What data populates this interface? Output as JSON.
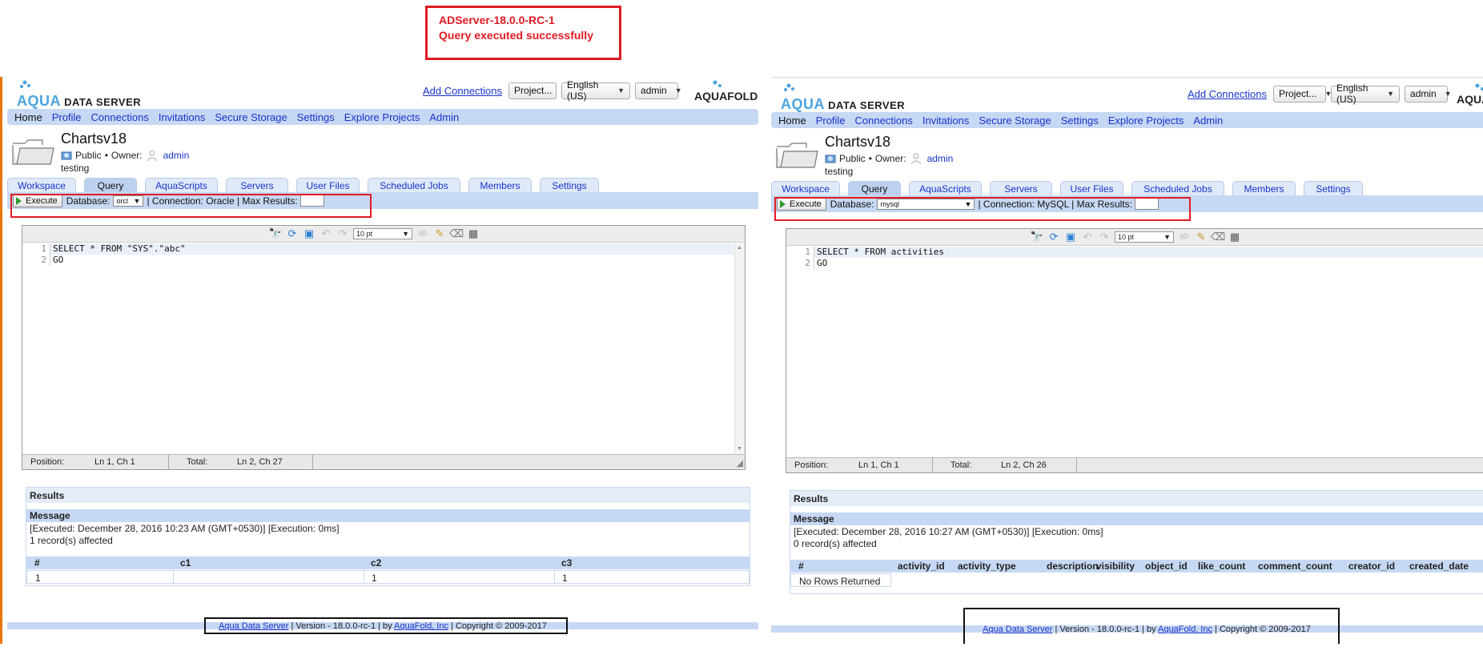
{
  "annotation": {
    "line1": "ADServer-18.0.0-RC-1",
    "line2": "Query executed successfully"
  },
  "panels": [
    {
      "logo": {
        "prefix": "AQUA",
        "suffix": "DATA SERVER"
      },
      "top": {
        "add_connections": "Add Connections",
        "project": "Project...",
        "language": "English (US)",
        "user": "admin",
        "brand": "AQUAFOLD"
      },
      "nav": [
        "Home",
        "Profile",
        "Connections",
        "Invitations",
        "Secure Storage",
        "Settings",
        "Explore Projects",
        "Admin"
      ],
      "project": {
        "name": "Chartsv18",
        "visibility": "Public",
        "bullet": "•",
        "owner_label": "Owner:",
        "owner": "admin",
        "description": "testing"
      },
      "tabs": [
        "Workspace",
        "Query",
        "AquaScripts",
        "Servers",
        "User Files",
        "Scheduled Jobs",
        "Members",
        "Settings"
      ],
      "toolbar": {
        "execute": "Execute",
        "database_label": "Database:",
        "database": "orcl",
        "connection_text": "| Connection: Oracle | Max Results:"
      },
      "editor": {
        "font_size": "10 pt",
        "lines": [
          "SELECT * FROM \"SYS\".\"abc\"",
          "GO"
        ],
        "line_numbers": [
          "1",
          "2"
        ],
        "status": {
          "position_label": "Position:",
          "position": "Ln 1, Ch 1",
          "total_label": "Total:",
          "total": "Ln 2, Ch 27"
        }
      },
      "results": {
        "title": "Results",
        "message_label": "Message",
        "executed": "[Executed: December 28, 2016 10:23 AM (GMT+0530)] [Execution: 0ms]",
        "affected": "1 record(s) affected",
        "columns": [
          "#",
          "c1",
          "c2",
          "c3"
        ],
        "row": [
          "1",
          "",
          "1",
          "1"
        ]
      },
      "footer": {
        "link1": "Aqua Data Server",
        "mid": "| Version - 18.0.0-rc-1 | by",
        "link2": "AquaFold, Inc",
        "end": "| Copyright © 2009-2017"
      }
    },
    {
      "logo": {
        "prefix": "AQUA",
        "suffix": "DATA SERVER"
      },
      "top": {
        "add_connections": "Add Connections",
        "project": "Project...",
        "language": "English (US)",
        "user": "admin",
        "brand": "AQUAFOLD"
      },
      "nav": [
        "Home",
        "Profile",
        "Connections",
        "Invitations",
        "Secure Storage",
        "Settings",
        "Explore Projects",
        "Admin"
      ],
      "project": {
        "name": "Chartsv18",
        "visibility": "Public",
        "bullet": "•",
        "owner_label": "Owner:",
        "owner": "admin",
        "description": "testing"
      },
      "tabs": [
        "Workspace",
        "Query",
        "AquaScripts",
        "Servers",
        "User Files",
        "Scheduled Jobs",
        "Members",
        "Settings"
      ],
      "toolbar": {
        "execute": "Execute",
        "database_label": "Database:",
        "database": "mysql",
        "connection_text": "| Connection: MySQL | Max Results:"
      },
      "editor": {
        "font_size": "10 pt",
        "lines": [
          "SELECT * FROM activities",
          "GO"
        ],
        "line_numbers": [
          "1",
          "2"
        ],
        "status": {
          "position_label": "Position:",
          "position": "Ln 1, Ch 1",
          "total_label": "Total:",
          "total": "Ln 2, Ch 26"
        }
      },
      "results": {
        "title": "Results",
        "message_label": "Message",
        "executed": "[Executed: December 28, 2016 10:27 AM (GMT+0530)] [Execution: 0ms]",
        "affected": "0 record(s) affected",
        "columns": [
          "#",
          "activity_id",
          "activity_type",
          "description",
          "visibility",
          "object_id",
          "like_count",
          "comment_count",
          "creator_id",
          "created_date"
        ],
        "no_rows": "No Rows Returned"
      },
      "footer": {
        "link1": "Aqua Data Server",
        "mid": "| Version - 18.0.0-rc-1 | by",
        "link2": "AquaFold, Inc",
        "end": "| Copyright © 2009-2017"
      }
    }
  ]
}
